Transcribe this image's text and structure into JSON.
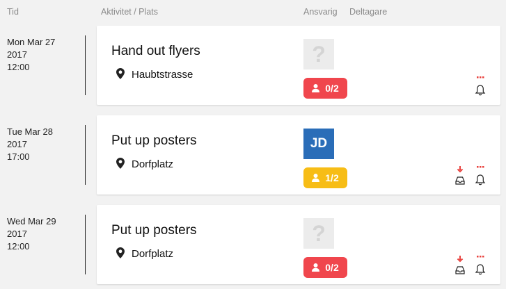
{
  "header": {
    "time": "Tid",
    "activity": "Aktivitet / Plats",
    "responsible": "Ansvarig",
    "participants": "Deltagare"
  },
  "colors": {
    "badge_red": "#f0464d",
    "badge_yellow": "#f7bd16",
    "avatar_blue": "#2a6db8",
    "alert_red": "#e8413d"
  },
  "rows": [
    {
      "date_line1": "Mon Mar 27",
      "date_line2": "2017",
      "date_line3": "12:00",
      "title": "Hand out flyers",
      "place": "Haubtstrasse",
      "avatar": "?",
      "badge": "0/2",
      "badge_color": "red",
      "icons": [
        "bell-icon"
      ]
    },
    {
      "date_line1": "Tue Mar 28",
      "date_line2": "2017",
      "date_line3": "17:00",
      "title": "Put up posters",
      "place": "Dorfplatz",
      "avatar": "JD",
      "badge": "1/2",
      "badge_color": "yellow",
      "icons": [
        "inbox-icon",
        "bell-icon"
      ]
    },
    {
      "date_line1": "Wed Mar 29",
      "date_line2": "2017",
      "date_line3": "12:00",
      "title": "Put up posters",
      "place": "Dorfplatz",
      "avatar": "?",
      "badge": "0/2",
      "badge_color": "red",
      "icons": [
        "inbox-icon",
        "bell-icon"
      ]
    }
  ]
}
